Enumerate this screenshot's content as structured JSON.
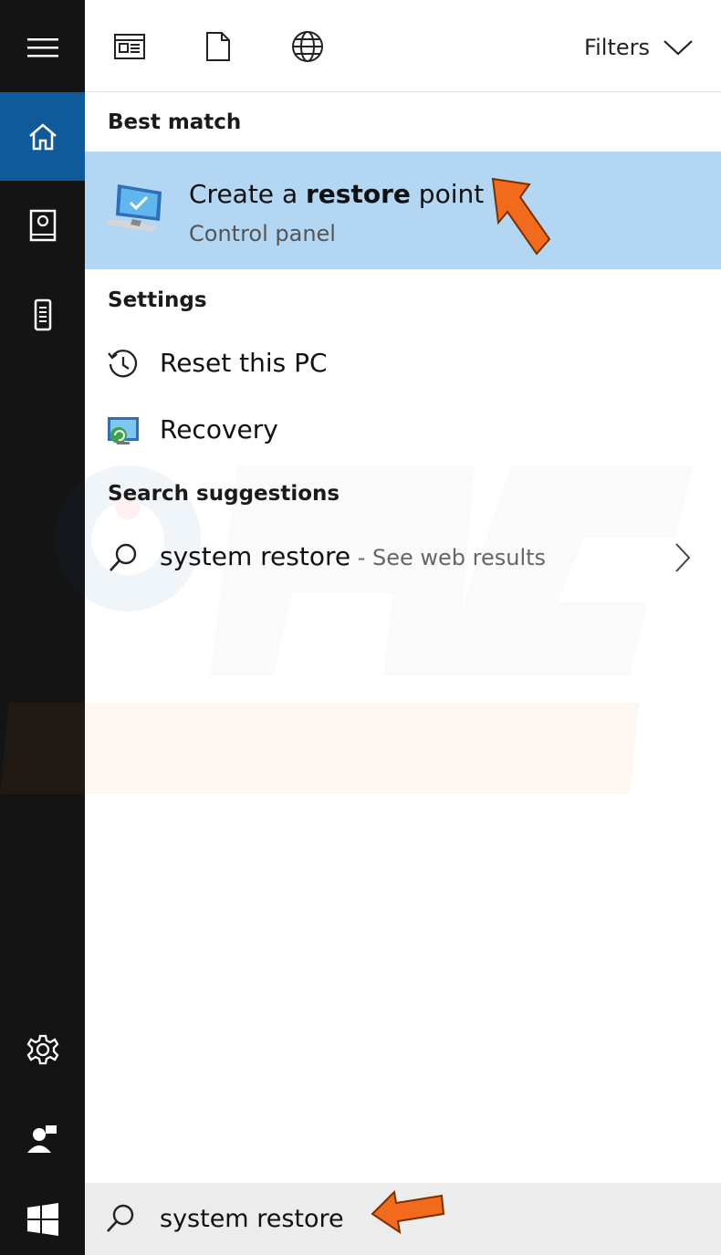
{
  "top_bar": {
    "icons": [
      "apps-icon",
      "document-icon",
      "web-icon"
    ],
    "filters_label": "Filters"
  },
  "rail": {
    "items": [
      {
        "name": "menu-icon"
      },
      {
        "name": "home-icon",
        "active": true
      },
      {
        "name": "notebook-icon"
      },
      {
        "name": "device-icon"
      },
      {
        "name": "settings-icon"
      },
      {
        "name": "user-icon"
      }
    ]
  },
  "best_match": {
    "heading": "Best match",
    "title_pre": "Create a ",
    "title_bold": "restore",
    "title_post": " point",
    "subtitle": "Control panel",
    "icon": "system-restore-monitor-icon"
  },
  "settings": {
    "heading": "Settings",
    "items": [
      {
        "label": "Reset this PC",
        "icon": "history-icon"
      },
      {
        "label": "Recovery",
        "icon": "recovery-icon"
      }
    ]
  },
  "suggestions": {
    "heading": "Search suggestions",
    "items": [
      {
        "query": "system restore",
        "extra": " - See web results",
        "icon": "search-icon"
      }
    ]
  },
  "search": {
    "value": "system restore"
  },
  "watermark_text": "PC risk.com",
  "colors": {
    "rail_bg": "#141414",
    "rail_active": "#0f5a9a",
    "highlight": "#b3d6f2",
    "annotation_arrow": "#f26a1b"
  }
}
